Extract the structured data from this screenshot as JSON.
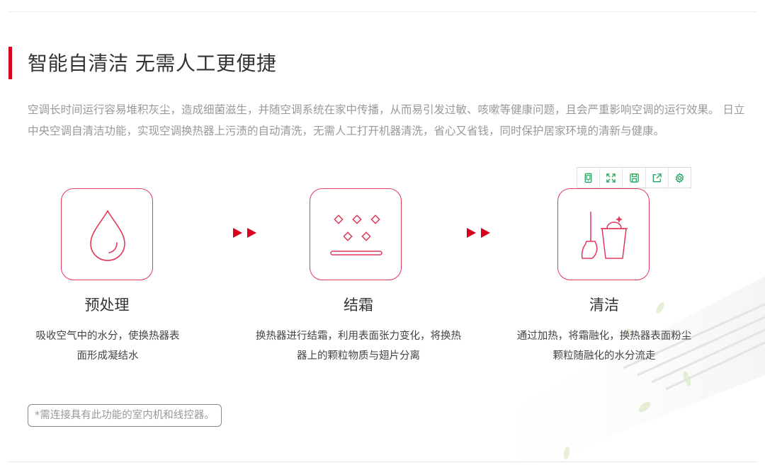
{
  "section": {
    "title": "智能自清洁 无需人工更便捷",
    "description": "空调长时间运行容易堆积灰尘，造成细菌滋生，并随空调系统在家中传播，从而易引发过敏、咳嗽等健康问题，且会严重影响空调的运行效果。 日立中央空调自清洁功能，实现空调换热器上污渍的自动清洗，无需人工打开机器清洗，省心又省钱，同时保护居家环境的清新与健康。",
    "accent_color": "#d7001d"
  },
  "toolbar": {
    "icon_color": "#27a35e",
    "buttons": [
      "tablet-icon",
      "expand-icon",
      "save-icon",
      "share-icon",
      "settings-icon"
    ]
  },
  "steps": [
    {
      "icon": "water-drop-icon",
      "title": "预处理",
      "line1": "吸收空气中的水分，使换热器表",
      "line2": "面形成凝结水"
    },
    {
      "icon": "frost-icon",
      "title": "结霜",
      "line1": "换热器进行结霜，利用表面张力变化，将换热",
      "line2": "器上的颗粒物质与翅片分离"
    },
    {
      "icon": "cleaning-icon",
      "title": "清洁",
      "line1": "通过加热，将霜融化，换热器表面粉尘",
      "line2": "颗粒随融化的水分流走"
    }
  ],
  "step_colors": {
    "outline": "#e0395a",
    "arrow": "#d7001d"
  },
  "note": "*需连接具有此功能的室内机和线控器。"
}
